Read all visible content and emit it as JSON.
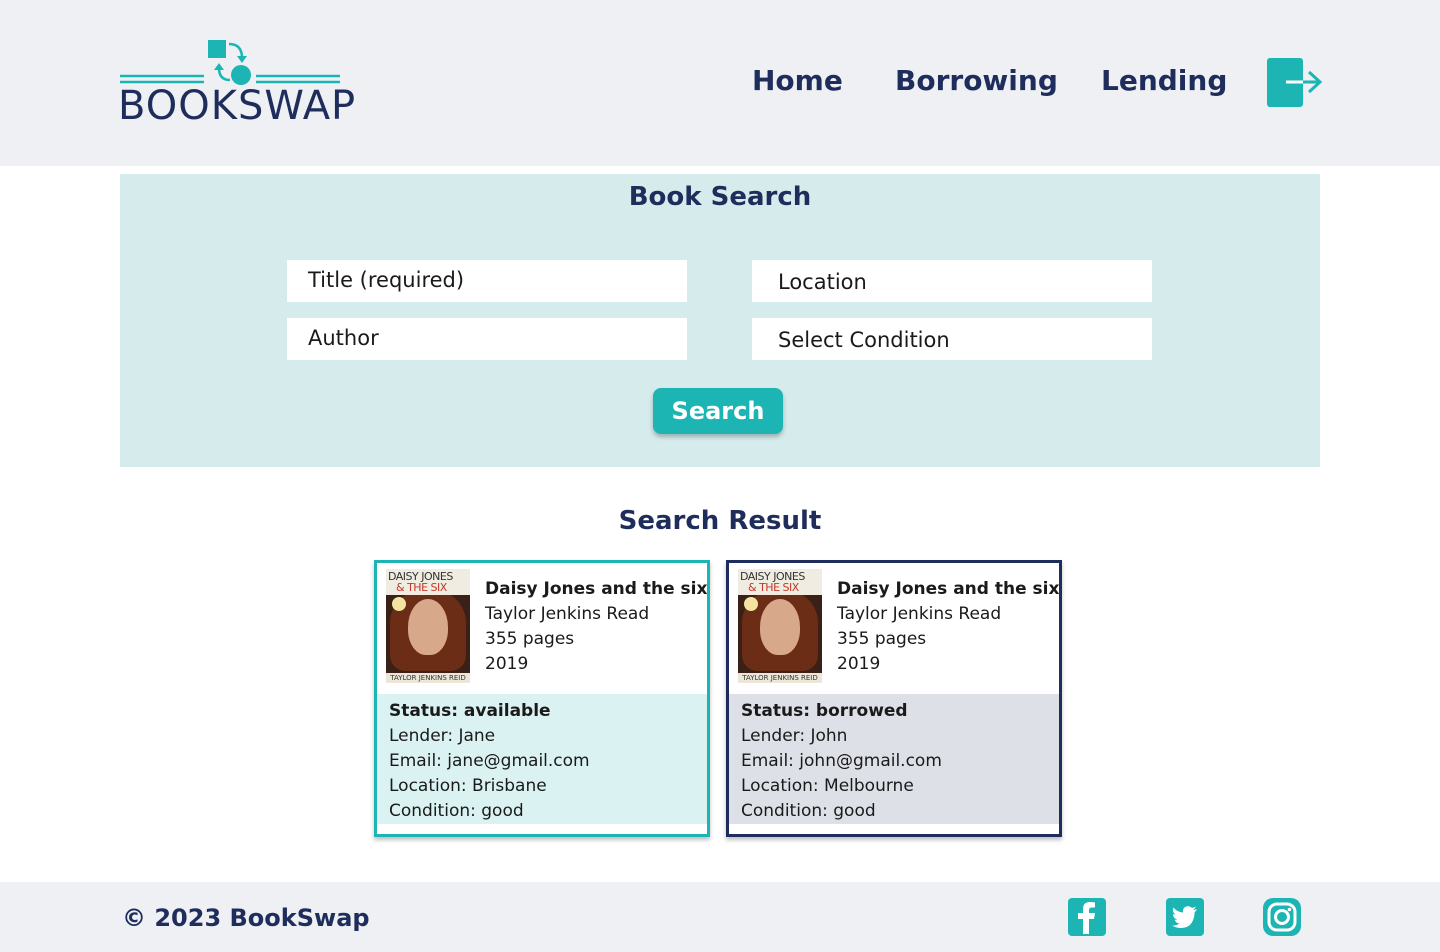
{
  "brand": {
    "name": "BOOKSWAP",
    "color": "#1f2d5c",
    "accent": "#1cb5b3"
  },
  "nav": {
    "home": "Home",
    "borrowing": "Borrowing",
    "lending": "Lending",
    "logout_icon": "logout-icon"
  },
  "search": {
    "title": "Book Search",
    "title_field": "Title (required)",
    "author_field": "Author",
    "location_field": "Location",
    "condition_field": "Select Condition",
    "button": "Search"
  },
  "results": {
    "title": "Search Result",
    "cards": [
      {
        "cover_line1": "DAISY JONES",
        "cover_line2": "& THE SIX",
        "cover_author": "TAYLOR JENKINS REID",
        "book_title": "Daisy Jones and the six",
        "author": "Taylor Jenkins Read",
        "pages": "355 pages",
        "year": "2019",
        "status": "Status: available",
        "lender": "Lender: Jane",
        "email": "Email: jane@gmail.com",
        "location": "Location: Brisbane",
        "condition": "Condition: good"
      },
      {
        "cover_line1": "DAISY JONES",
        "cover_line2": "& THE SIX",
        "cover_author": "TAYLOR JENKINS REID",
        "book_title": "Daisy Jones and the six",
        "author": "Taylor Jenkins Read",
        "pages": "355 pages",
        "year": "2019",
        "status": "Status: borrowed",
        "lender": "Lender: John",
        "email": "Email: john@gmail.com",
        "location": "Location: Melbourne",
        "condition": "Condition: good"
      }
    ]
  },
  "footer": {
    "copyright": "© 2023 BookSwap",
    "social": [
      "facebook-icon",
      "twitter-icon",
      "instagram-icon"
    ]
  }
}
